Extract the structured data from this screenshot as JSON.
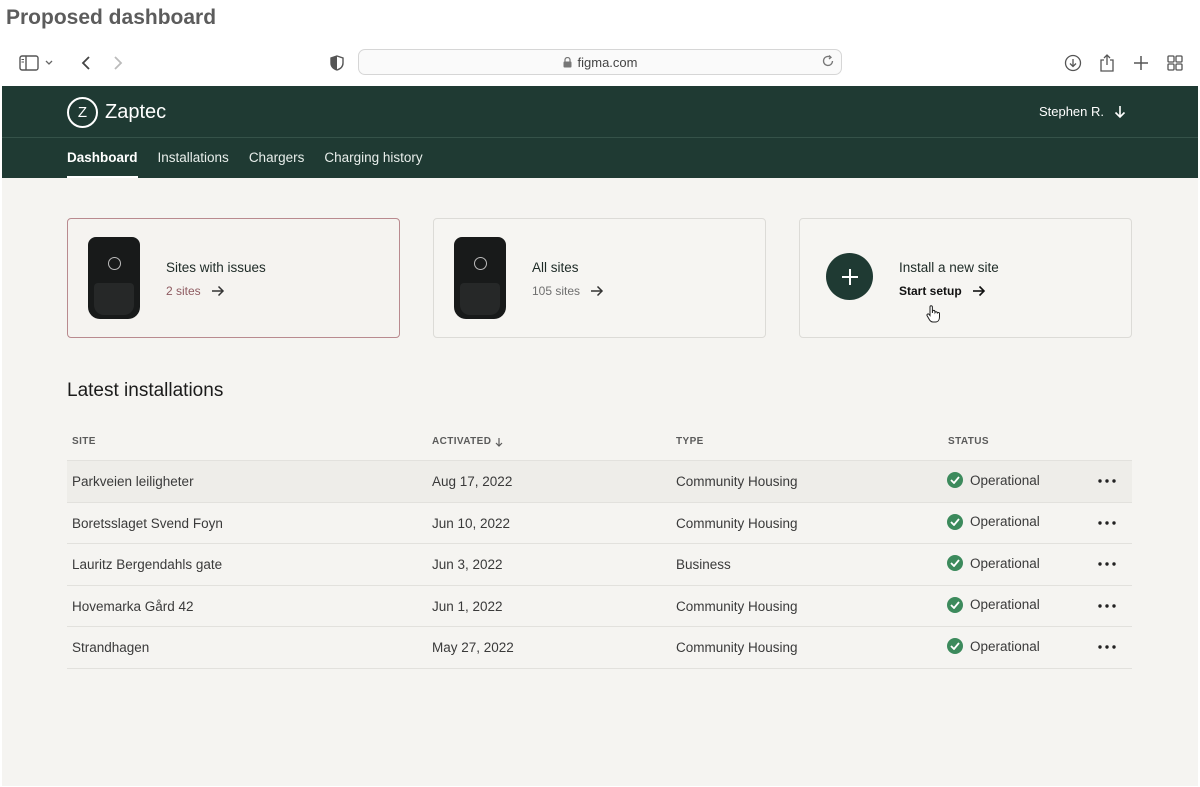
{
  "page": {
    "title": "Proposed dashboard"
  },
  "browser": {
    "url": "figma.com"
  },
  "app": {
    "brand": "Zaptec",
    "brand_logo_letter": "Z",
    "user": "Stephen R.",
    "nav": [
      "Dashboard",
      "Installations",
      "Chargers",
      "Charging history"
    ],
    "active_nav": "Dashboard"
  },
  "cards": {
    "issues": {
      "title": "Sites with issues",
      "sub": "2 sites"
    },
    "all": {
      "title": "All sites",
      "sub": "105 sites"
    },
    "install": {
      "title": "Install a new site",
      "action": "Start setup"
    }
  },
  "section_title": "Latest installations",
  "table": {
    "headers": {
      "site": "SITE",
      "activated": "ACTIVATED",
      "type": "TYPE",
      "status": "STATUS"
    },
    "rows": [
      {
        "site": "Parkveien leiligheter",
        "activated": "Aug 17, 2022",
        "type": "Community Housing",
        "status": "Operational"
      },
      {
        "site": "Boretsslaget Svend Foyn",
        "activated": "Jun 10, 2022",
        "type": "Community Housing",
        "status": "Operational"
      },
      {
        "site": "Lauritz Bergendahls gate",
        "activated": "Jun 3, 2022",
        "type": "Business",
        "status": "Operational"
      },
      {
        "site": "Hovemarka Gård 42",
        "activated": "Jun 1, 2022",
        "type": "Community Housing",
        "status": "Operational"
      },
      {
        "site": "Strandhagen",
        "activated": "May 27, 2022",
        "type": "Community Housing",
        "status": "Operational"
      }
    ]
  },
  "colors": {
    "header_bg": "#1f3a33",
    "status_ok": "#3c8a5c",
    "issue_border": "#b98a8f"
  }
}
